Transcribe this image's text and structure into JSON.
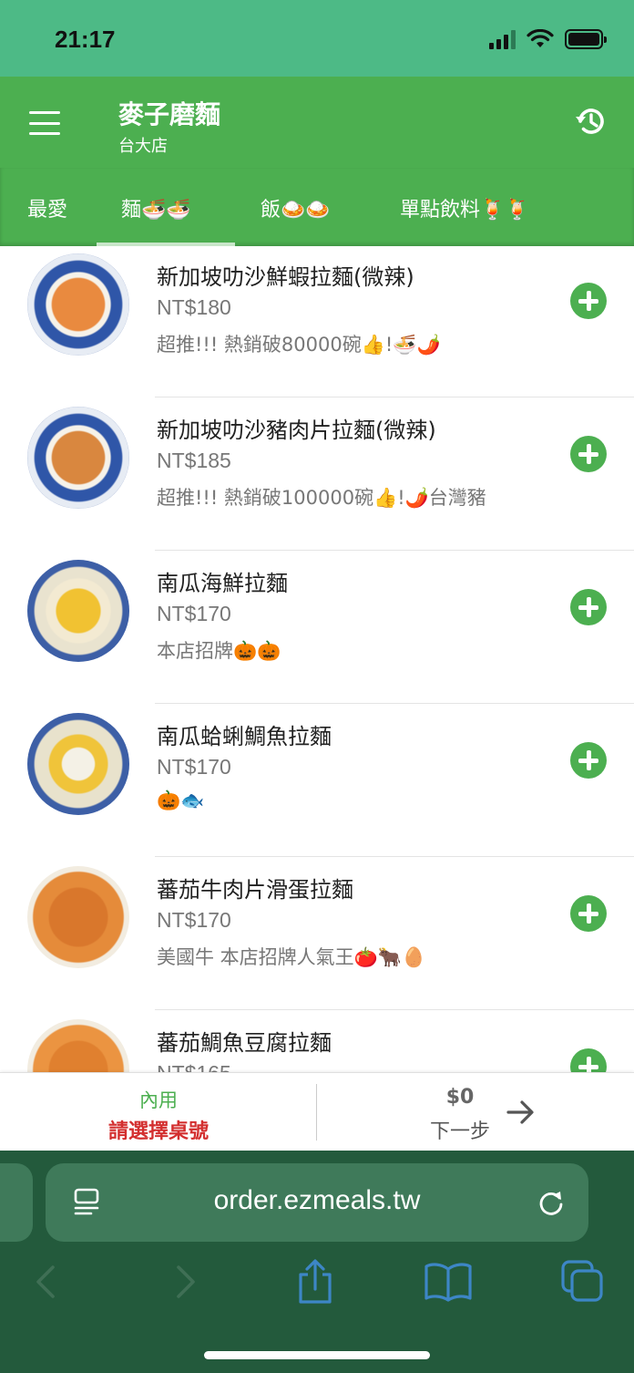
{
  "status_bar": {
    "time": "21:17"
  },
  "header": {
    "store_name": "麥子磨麵",
    "branch": "台大店"
  },
  "tabs": [
    {
      "label": "最愛"
    },
    {
      "label": "麵🍜🍜",
      "active": true
    },
    {
      "label": "飯🍛🍛"
    },
    {
      "label": "單點飲料🍹🍹"
    }
  ],
  "menu_items": [
    {
      "name": "新加坡叻沙鮮蝦拉麵(微辣)",
      "price": "NT$180",
      "desc": "超推!!! 熱銷破80000碗👍!🍜🌶️"
    },
    {
      "name": "新加坡叻沙豬肉片拉麵(微辣)",
      "price": "NT$185",
      "desc": "超推!!! 熱銷破100000碗👍!🌶️台灣豬"
    },
    {
      "name": "南瓜海鮮拉麵",
      "price": "NT$170",
      "desc": "本店招牌🎃🎃"
    },
    {
      "name": "南瓜蛤蜊鯛魚拉麵",
      "price": "NT$170",
      "desc": "🎃🐟"
    },
    {
      "name": "蕃茄牛肉片滑蛋拉麵",
      "price": "NT$170",
      "desc": "美國牛 本店招牌人氣王🍅🐂🥚"
    },
    {
      "name": "蕃茄鯛魚豆腐拉麵",
      "price": "NT$165",
      "desc": ""
    }
  ],
  "order_bar": {
    "dine_type": "內用",
    "table_prompt": "請選擇桌號",
    "total": "$0",
    "next_label": "下一步"
  },
  "browser": {
    "url": "order.ezmeals.tw"
  },
  "colors": {
    "status_bar": "#4dba86",
    "header": "#4caf50",
    "add_button": "#4caf50",
    "table_prompt": "#d32f2f",
    "browser_chrome": "#235a3c",
    "browser_icons": "#3d86c6"
  }
}
